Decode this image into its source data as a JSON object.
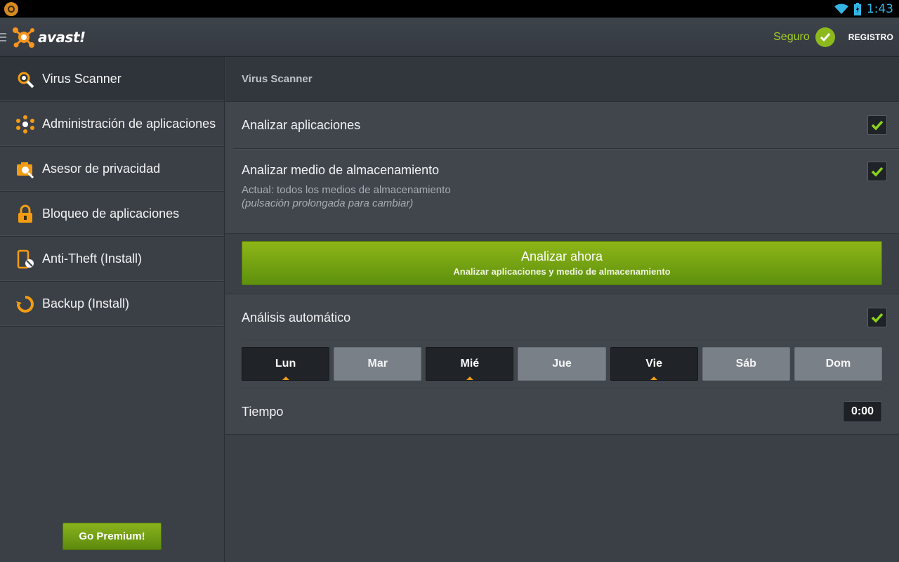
{
  "status_bar": {
    "time": "1:43"
  },
  "header": {
    "logo_text": "avast!",
    "status_label": "Seguro",
    "register_label": "REGISTRO"
  },
  "sidebar": {
    "items": [
      {
        "label": "Virus Scanner",
        "icon": "virus-scanner-icon",
        "active": true
      },
      {
        "label": "Administración de aplicaciones",
        "icon": "app-management-icon",
        "active": false
      },
      {
        "label": "Asesor de privacidad",
        "icon": "privacy-advisor-icon",
        "active": false
      },
      {
        "label": "Bloqueo de aplicaciones",
        "icon": "lock-icon",
        "active": false
      },
      {
        "label": "Anti-Theft (Install)",
        "icon": "anti-theft-icon",
        "active": false
      },
      {
        "label": "Backup (Install)",
        "icon": "backup-icon",
        "active": false
      }
    ],
    "premium_button": "Go Premium!"
  },
  "main": {
    "title": "Virus Scanner",
    "scan_apps": {
      "label": "Analizar aplicaciones",
      "checked": true
    },
    "scan_storage": {
      "label": "Analizar medio de almacenamiento",
      "current": "Actual: todos los medios de almacenamiento",
      "hint": "(pulsación prolongada para cambiar)",
      "checked": true
    },
    "scan_button": {
      "label": "Analizar ahora",
      "sublabel": "Analizar aplicaciones y medio de almacenamiento"
    },
    "auto_scan": {
      "label": "Análisis automático",
      "checked": true
    },
    "days": [
      {
        "label": "Lun",
        "selected": true
      },
      {
        "label": "Mar",
        "selected": false
      },
      {
        "label": "Mié",
        "selected": true
      },
      {
        "label": "Jue",
        "selected": false
      },
      {
        "label": "Vie",
        "selected": true
      },
      {
        "label": "Sáb",
        "selected": false
      },
      {
        "label": "Dom",
        "selected": false
      }
    ],
    "time": {
      "label": "Tiempo",
      "value": "0:00"
    }
  },
  "colors": {
    "accent_green": "#8cba1d",
    "accent_orange": "#f39c12",
    "status_blue": "#33b5e5"
  }
}
